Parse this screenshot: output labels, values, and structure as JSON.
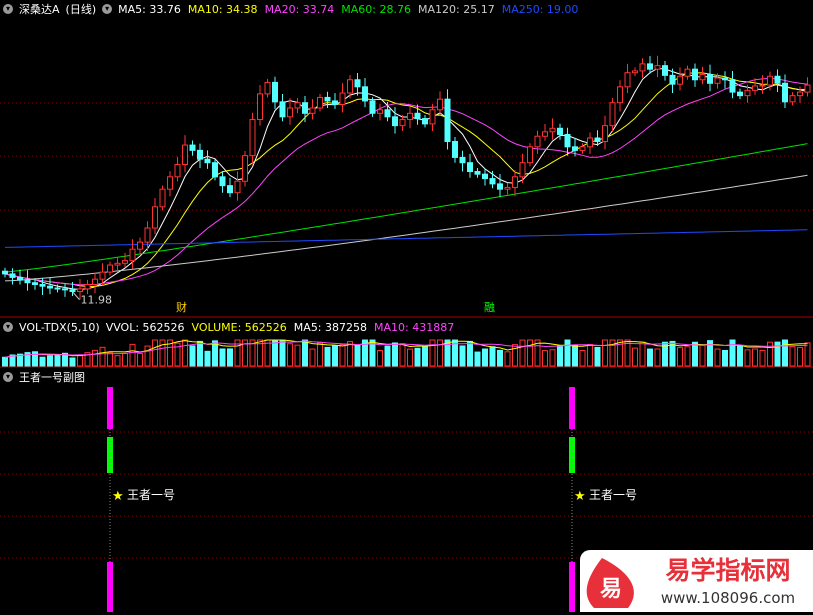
{
  "main_panel": {
    "stock_name": "深桑达A",
    "period": "(日线)",
    "ma_legend": [
      {
        "label": "MA5:",
        "value": "33.76",
        "color": "#ffffff"
      },
      {
        "label": "MA10:",
        "value": "34.38",
        "color": "#ffff00"
      },
      {
        "label": "MA20:",
        "value": "33.74",
        "color": "#ff44ff"
      },
      {
        "label": "MA60:",
        "value": "28.76",
        "color": "#00e000"
      },
      {
        "label": "MA120:",
        "value": "25.17",
        "color": "#cccccc"
      },
      {
        "label": "MA250:",
        "value": "19.00",
        "color": "#1e4bff"
      }
    ],
    "low_label": "11.98",
    "event_markers": [
      "财",
      "融"
    ]
  },
  "volume_panel": {
    "indicator": "VOL-TDX(5,10)",
    "legend": [
      {
        "label": "VVOL:",
        "value": "562526",
        "color": "#ffffff"
      },
      {
        "label": "VOLUME:",
        "value": "562526",
        "color": "#ffff00"
      },
      {
        "label": "MA5:",
        "value": "387258",
        "color": "#ffffff"
      },
      {
        "label": "MA10:",
        "value": "431887",
        "color": "#ff44ff"
      }
    ]
  },
  "sub_panel": {
    "title": "王者一号副图",
    "signal_label": "王者一号",
    "signal_count": 2
  },
  "watermark": {
    "logo_char": "易",
    "name": "易学指标网",
    "url": "www.108096.com"
  },
  "colors": {
    "up": "#ff3232",
    "down": "#54ffff",
    "grid": "#8b0000",
    "separator": "#aa0000",
    "signal_magenta": "#ff00ff",
    "signal_green": "#00ff00",
    "star": "#ffff00"
  },
  "chart_data": {
    "type": "candlestick",
    "title": "深桑达A (日线)",
    "candles_count": 108,
    "price_range": [
      9,
      43
    ],
    "lowest_price": 11.98,
    "latest_ma": {
      "MA5": 33.76,
      "MA10": 34.38,
      "MA20": 33.74,
      "MA60": 28.76,
      "MA120": 25.17,
      "MA250": 19.0
    },
    "latest_volume": {
      "VVOL": 562526,
      "VOLUME": 562526,
      "MA5": 387258,
      "MA10": 431887
    },
    "closes": [
      14.0,
      13.6,
      13.3,
      13.0,
      12.8,
      12.6,
      12.4,
      12.3,
      12.2,
      12.0,
      12.3,
      12.8,
      13.4,
      14.2,
      15.0,
      15.2,
      15.5,
      16.8,
      17.6,
      19.2,
      21.6,
      23.6,
      25.0,
      26.4,
      28.6,
      28.0,
      27.0,
      26.6,
      25.0,
      24.0,
      23.2,
      24.5,
      27.4,
      31.5,
      34.4,
      35.7,
      33.5,
      31.8,
      32.8,
      33.4,
      32.2,
      32.8,
      34.0,
      33.6,
      33.2,
      34.5,
      36.0,
      35.2,
      33.6,
      32.2,
      32.6,
      31.8,
      30.8,
      31.5,
      32.2,
      31.6,
      31.0,
      32.6,
      33.8,
      29.0,
      27.2,
      26.6,
      25.6,
      25.3,
      24.8,
      24.2,
      23.6,
      23.8,
      25.0,
      26.6,
      28.4,
      29.6,
      30.1,
      30.5,
      29.8,
      28.4,
      28.0,
      28.4,
      29.4,
      29.0,
      30.8,
      33.4,
      35.2,
      36.8,
      37.0,
      37.8,
      37.2,
      37.6,
      36.5,
      35.5,
      36.4,
      37.2,
      36.0,
      36.6,
      35.6,
      36.2,
      36.0,
      34.6,
      34.2,
      34.8,
      35.3,
      35.4,
      36.4,
      35.6,
      33.5,
      34.2,
      34.6,
      35.4
    ]
  }
}
